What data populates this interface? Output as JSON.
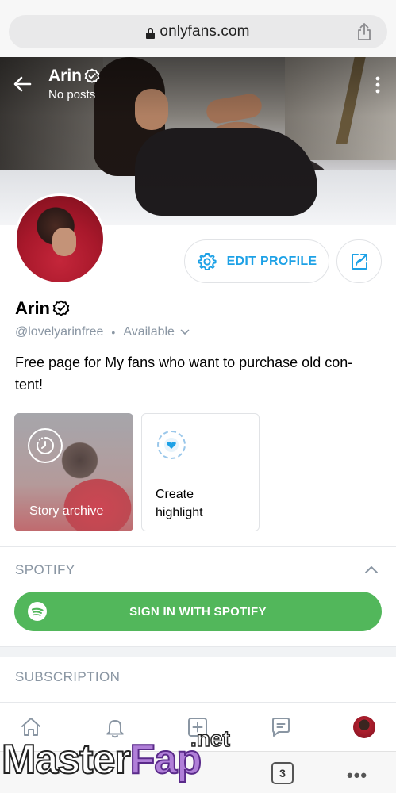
{
  "browser": {
    "url": "onlyfans.com"
  },
  "profile": {
    "cover_name": "Arin",
    "cover_subtitle": "No posts",
    "name": "Arin",
    "handle": "@lovelyarinfree",
    "separator": "•",
    "availability": "Available",
    "bio": "Free page for My fans who want to purchase old con-tent!",
    "edit_label": "EDIT PROFILE"
  },
  "highlights": {
    "story_archive": "Story archive",
    "create_line1": "Create",
    "create_line2": "highlight"
  },
  "spotify": {
    "title": "SPOTIFY",
    "button_label": "SIGN IN WITH SPOTIFY"
  },
  "subscription": {
    "title": "SUBSCRIPTION"
  },
  "browser_toolbar": {
    "tabs_count": "3",
    "more": "•••"
  },
  "watermark": {
    "part1": "Master",
    "part2": "Fap",
    "suffix": ".net"
  },
  "colors": {
    "accent": "#1da1e6",
    "spotify_green": "#52b75b",
    "muted_text": "#8a96a3"
  },
  "icons": [
    "lock-icon",
    "share-icon",
    "back-arrow-icon",
    "verified-icon",
    "more-vertical-icon",
    "gear-icon",
    "share-profile-icon",
    "chevron-down-icon",
    "chevron-up-icon",
    "clock-icon",
    "heart-icon",
    "spotify-icon",
    "home-icon",
    "bell-icon",
    "plus-square-icon",
    "message-icon"
  ]
}
